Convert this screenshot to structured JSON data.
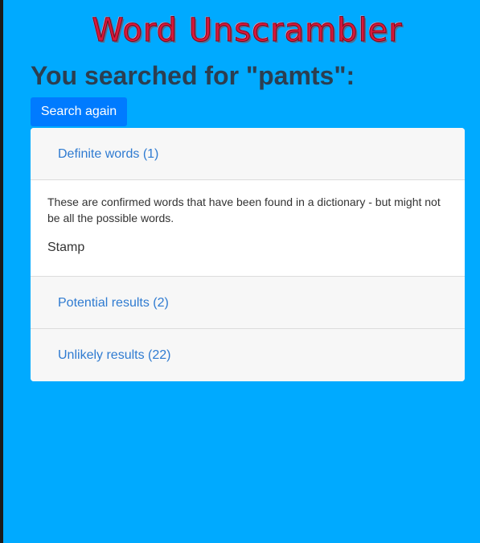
{
  "logo": {
    "text": "Word Unscrambler"
  },
  "heading": "You searched for \"pamts\":",
  "search_again_label": "Search again",
  "sections": [
    {
      "label": "Definite words (1)"
    },
    {
      "label": "Potential results (2)"
    },
    {
      "label": "Unlikely results (22)"
    }
  ],
  "definite": {
    "description": "These are confirmed words that have been found in a dictionary - but might not be all the possible words.",
    "words": [
      "Stamp"
    ]
  },
  "colors": {
    "background": "#00aaff",
    "logo": "#d9183b",
    "heading": "#2c3e50",
    "button": "#007bff",
    "link": "#2f7bd1"
  }
}
